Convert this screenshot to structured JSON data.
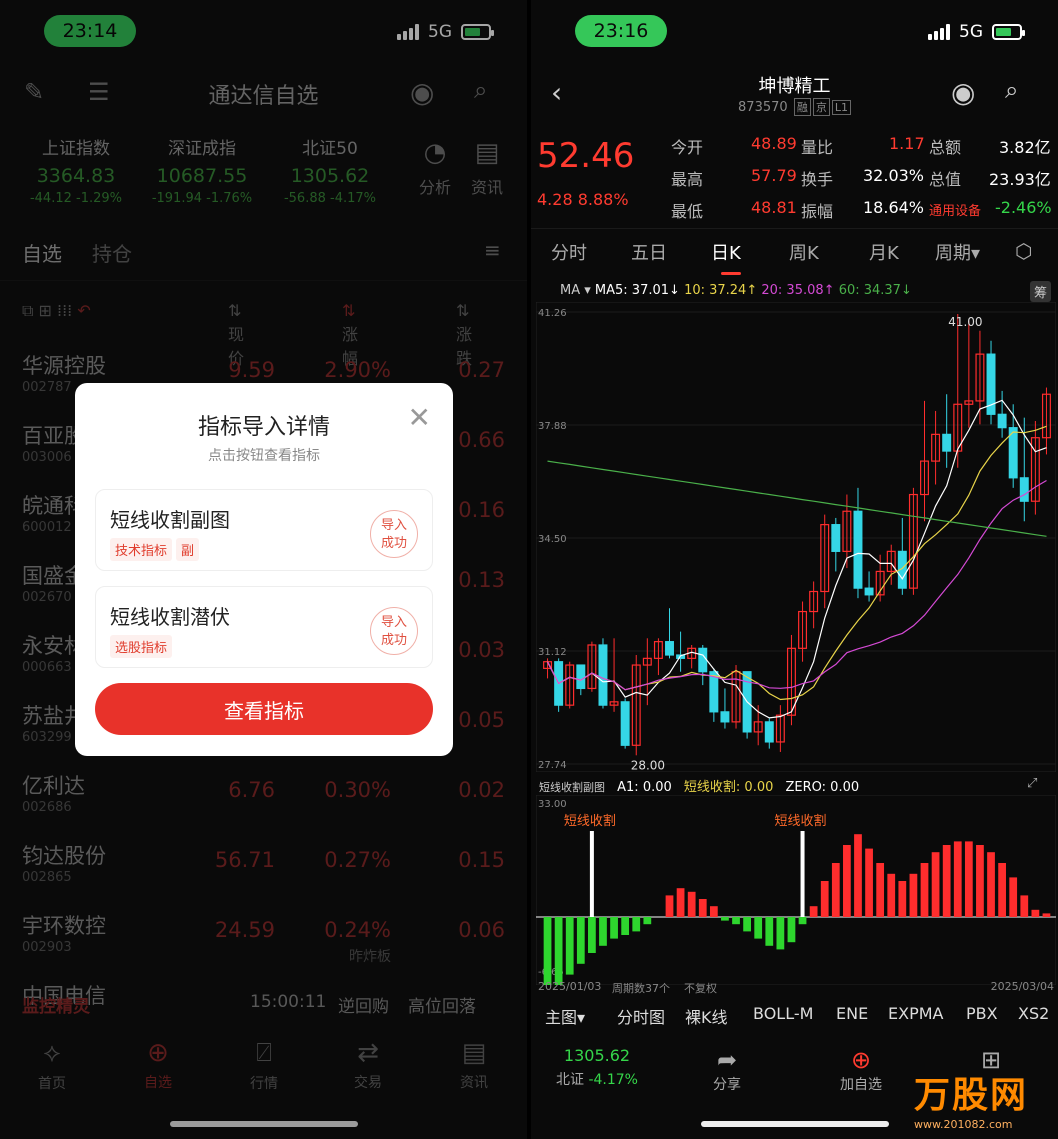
{
  "left": {
    "status": {
      "time": "23:14",
      "network": "5G"
    },
    "header": {
      "title": "通达信自选"
    },
    "indices": [
      {
        "name": "上证指数",
        "value": "3364.83",
        "change": "-44.12",
        "pct": "-1.29%"
      },
      {
        "name": "深证成指",
        "value": "10687.55",
        "change": "-191.94",
        "pct": "-1.76%"
      },
      {
        "name": "北证50",
        "value": "1305.62",
        "change": "-56.88",
        "pct": "-4.17%"
      }
    ],
    "quick_buttons": [
      "分析",
      "资讯"
    ],
    "tabs": [
      "自选",
      "持仓"
    ],
    "columns": {
      "price": "现价",
      "pct": "涨幅",
      "change": "涨跌"
    },
    "rows": [
      {
        "name": "华源控股",
        "code": "002787",
        "price": "9.59",
        "pct": "2.90%",
        "change": "0.27",
        "sub": ""
      },
      {
        "name": "百亚股份",
        "code": "003006",
        "price": "",
        "pct": "",
        "change": "0.66",
        "sub": ""
      },
      {
        "name": "皖通科技",
        "code": "600012",
        "price": "",
        "pct": "",
        "change": "0.16",
        "sub": ""
      },
      {
        "name": "国盛金控",
        "code": "002670",
        "price": "",
        "pct": "",
        "change": "0.13",
        "sub": ""
      },
      {
        "name": "永安林业",
        "code": "000663",
        "price": "",
        "pct": "",
        "change": "0.03",
        "sub": ""
      },
      {
        "name": "苏盐井神",
        "code": "603299",
        "price": "",
        "pct": "",
        "change": "0.05",
        "sub": ""
      },
      {
        "name": "亿利达",
        "code": "002686",
        "price": "6.76",
        "pct": "0.30%",
        "change": "0.02",
        "sub": ""
      },
      {
        "name": "钧达股份",
        "code": "002865",
        "price": "56.71",
        "pct": "0.27%",
        "change": "0.15",
        "sub": ""
      },
      {
        "name": "宇环数控",
        "code": "002903",
        "price": "24.59",
        "pct": "0.24%",
        "change": "0.06",
        "sub": "昨炸板"
      },
      {
        "name": "中国电信",
        "code": "",
        "price": "",
        "pct": "",
        "change": "",
        "sub": ""
      }
    ],
    "monitor": {
      "label": "监控精灵",
      "time": "15:00:11",
      "event": "逆回购",
      "event2": "高位回落"
    },
    "bottom_nav": [
      "首页",
      "自选",
      "行情",
      "交易",
      "资讯"
    ],
    "modal": {
      "title": "指标导入详情",
      "subtitle": "点击按钮查看指标",
      "items": [
        {
          "name": "短线收割副图",
          "tags": [
            "技术指标",
            "副"
          ],
          "status_line1": "导入",
          "status_line2": "成功"
        },
        {
          "name": "短线收割潜伏",
          "tags": [
            "选股指标"
          ],
          "status_line1": "导入",
          "status_line2": "成功"
        }
      ],
      "button": "查看指标"
    }
  },
  "right": {
    "status": {
      "time": "23:16",
      "network": "5G"
    },
    "header": {
      "title": "坤博精工",
      "code": "873570",
      "badge1": "融",
      "badge2": "京",
      "badge3": "L1"
    },
    "quote": {
      "price": "52.46",
      "change": "4.28",
      "pct": "8.88%",
      "open_label": "今开",
      "open": "48.89",
      "vol_ratio_label": "量比",
      "vol_ratio": "1.17",
      "amount_label": "总额",
      "amount": "3.82亿",
      "high_label": "最高",
      "high": "57.79",
      "turnover_label": "换手",
      "turnover": "32.03%",
      "mcap_label": "总值",
      "mcap": "23.93亿",
      "low_label": "最低",
      "low": "48.81",
      "amplitude_label": "振幅",
      "amplitude": "18.64%",
      "sector": "通用设备",
      "sector_pct": "-2.46%"
    },
    "tabs": [
      "分时",
      "五日",
      "日K",
      "周K",
      "月K",
      "周期▾"
    ],
    "ma": {
      "label": "MA",
      "ma5": "MA5: 37.01↓",
      "ma10": "10: 37.24↑",
      "ma20": "20: 35.08↑",
      "ma60": "60: 34.37↓",
      "btn": "筹"
    },
    "colors": {
      "up": "#ff2d2d",
      "down": "#35d6e6",
      "ma5": "#ffffff",
      "ma10": "#e8d44a",
      "ma20": "#d44ad4",
      "ma60": "#4ab04a"
    },
    "chart_data": [
      {
        "type": "candlestick",
        "title": "",
        "y_ticks": [
          "41.26",
          "37.88",
          "34.50",
          "31.12",
          "27.74"
        ],
        "ylim": [
          27.74,
          41.26
        ],
        "annotations": [
          "41.00",
          "28.00"
        ],
        "candles": [
          [
            30.6,
            30.9,
            30.3,
            30.8
          ],
          [
            30.8,
            30.9,
            29.3,
            29.5
          ],
          [
            29.5,
            30.8,
            29.4,
            30.7
          ],
          [
            30.7,
            30.6,
            29.8,
            30.0
          ],
          [
            30.0,
            31.4,
            29.9,
            31.3
          ],
          [
            31.3,
            31.5,
            29.4,
            29.5
          ],
          [
            29.5,
            31.5,
            29.3,
            29.6
          ],
          [
            29.6,
            29.7,
            28.2,
            28.3
          ],
          [
            28.3,
            31.0,
            28.0,
            30.7
          ],
          [
            30.7,
            31.5,
            29.5,
            30.9
          ],
          [
            30.9,
            31.5,
            30.4,
            31.4
          ],
          [
            31.4,
            32.4,
            30.9,
            31.0
          ],
          [
            31.0,
            31.7,
            30.5,
            30.9
          ],
          [
            30.9,
            31.3,
            30.6,
            31.2
          ],
          [
            31.2,
            31.3,
            30.1,
            30.5
          ],
          [
            30.5,
            30.6,
            29.0,
            29.3
          ],
          [
            29.3,
            30.0,
            28.8,
            29.0
          ],
          [
            29.0,
            30.7,
            28.8,
            30.5
          ],
          [
            30.5,
            30.3,
            28.5,
            28.7
          ],
          [
            28.7,
            29.5,
            28.3,
            29.0
          ],
          [
            29.0,
            29.1,
            28.2,
            28.4
          ],
          [
            28.4,
            29.5,
            28.1,
            29.2
          ],
          [
            29.2,
            31.6,
            28.9,
            31.2
          ],
          [
            31.2,
            32.6,
            30.8,
            32.3
          ],
          [
            32.3,
            33.2,
            31.8,
            32.9
          ],
          [
            32.9,
            35.2,
            32.4,
            34.9
          ],
          [
            34.9,
            35.1,
            33.5,
            34.1
          ],
          [
            34.1,
            35.8,
            33.6,
            35.3
          ],
          [
            35.3,
            36.0,
            32.7,
            33.0
          ],
          [
            33.0,
            33.5,
            32.6,
            32.8
          ],
          [
            32.8,
            34.0,
            32.6,
            33.5
          ],
          [
            33.5,
            34.3,
            33.1,
            34.1
          ],
          [
            34.1,
            35.1,
            32.8,
            33.0
          ],
          [
            33.0,
            36.0,
            32.8,
            35.8
          ],
          [
            35.8,
            38.6,
            35.0,
            36.8
          ],
          [
            36.8,
            38.3,
            36.1,
            37.6
          ],
          [
            37.6,
            38.8,
            36.6,
            37.1
          ],
          [
            37.1,
            41.2,
            36.6,
            38.5
          ],
          [
            38.5,
            41.0,
            37.8,
            38.6
          ],
          [
            38.6,
            40.7,
            37.9,
            40.0
          ],
          [
            40.0,
            40.4,
            37.9,
            38.2
          ],
          [
            38.2,
            38.9,
            37.5,
            37.8
          ],
          [
            37.8,
            38.5,
            36.0,
            36.3
          ],
          [
            36.3,
            38.1,
            35.0,
            35.6
          ],
          [
            35.6,
            38.0,
            35.2,
            37.5
          ],
          [
            37.5,
            39.0,
            37.0,
            38.8
          ]
        ]
      },
      {
        "type": "bar",
        "title": "短线收割副图",
        "legend": {
          "a1": "A1: 0.00",
          "dx": "短线收割: 0.00",
          "zero": "ZERO: 0.00"
        },
        "y_ticks": [
          "33.00",
          "-6.65"
        ],
        "signal_label": "短线收割",
        "values": [
          -22,
          -19,
          -16,
          -13,
          -10,
          -8,
          -6,
          -5,
          -4,
          -2,
          0,
          6,
          8,
          7,
          5,
          3,
          -1,
          -2,
          -4,
          -6,
          -8,
          -9,
          -7,
          -2,
          3,
          10,
          15,
          20,
          23,
          19,
          15,
          12,
          10,
          12,
          15,
          18,
          20,
          21,
          21,
          20,
          18,
          15,
          11,
          6,
          2,
          1
        ],
        "x_start": "2025/01/03",
        "x_end": "2025/03/04",
        "period_note": "周期数37个",
        "adjust_note": "不复权"
      }
    ],
    "toolbar": [
      "主图▾",
      "分时图",
      "裸K线",
      "BOLL-M",
      "ENE",
      "EXPMA",
      "PBX",
      "XS2"
    ],
    "bottom": {
      "index_value": "1305.62",
      "index_name": "北证",
      "index_pct": "-4.17%",
      "share": "分享",
      "add": "加自选"
    },
    "watermark": {
      "brand": "万股网",
      "url": "www.201082.com"
    }
  }
}
